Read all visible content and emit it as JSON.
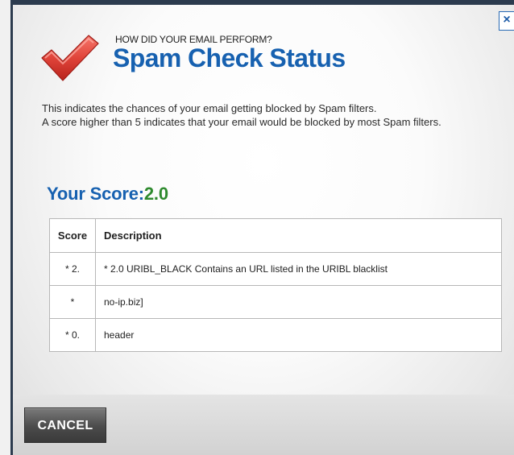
{
  "dialog": {
    "close_label": "×",
    "kicker": "HOW DID YOUR EMAIL PERFORM?",
    "title": "Spam Check Status",
    "description_line1": "This indicates the chances of your email getting blocked by Spam filters.",
    "description_line2": "A score higher than 5 indicates that your email would be blocked by most Spam filters.",
    "score_label": "Your Score:",
    "score_value": "2.0",
    "cancel_label": "CANCEL"
  },
  "table": {
    "headers": [
      "Score",
      "Description"
    ],
    "rows": [
      {
        "score": "* 2.",
        "description": "* 2.0 URIBL_BLACK Contains an URL listed in the URIBL blacklist"
      },
      {
        "score": "*",
        "description": "no-ip.biz]"
      },
      {
        "score": "* 0.",
        "description": "header"
      }
    ]
  },
  "colors": {
    "title_blue": "#1761b0",
    "score_green": "#2e8a2e",
    "check_red": "#e0443a",
    "button_dark": "#4b4b4b"
  },
  "icons": {
    "check": "checkmark-icon",
    "close": "close-icon"
  }
}
